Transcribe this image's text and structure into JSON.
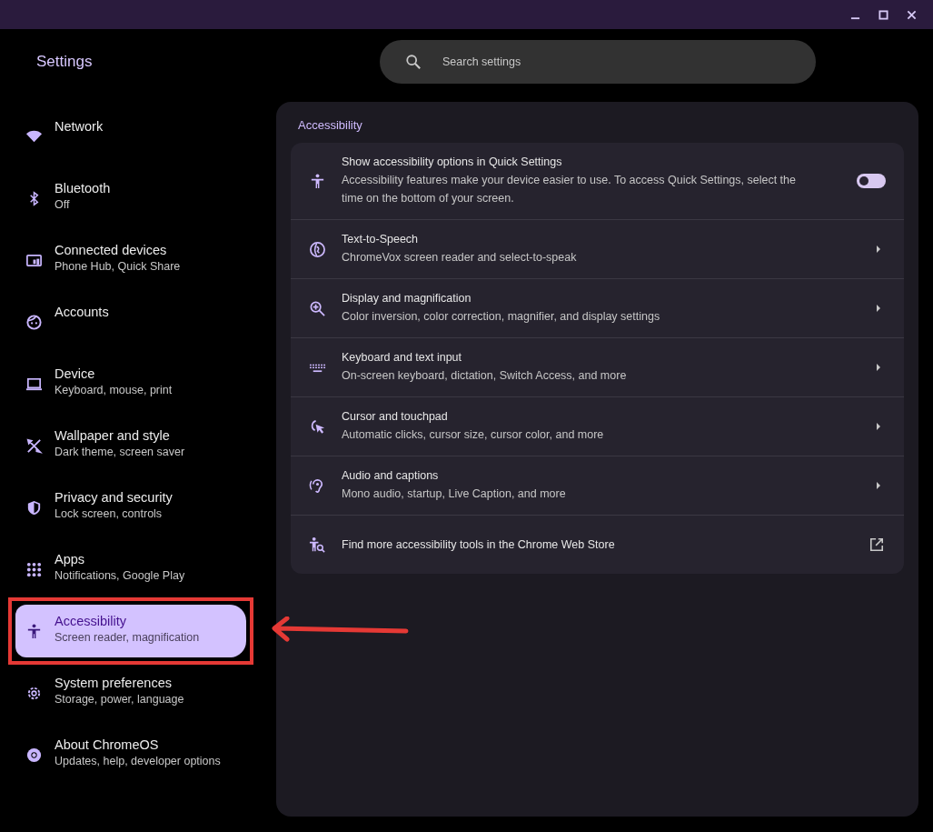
{
  "app_title": "Settings",
  "search": {
    "placeholder": "Search settings"
  },
  "sidebar": {
    "items": [
      {
        "title": "Network",
        "selected": false
      },
      {
        "title": "Bluetooth",
        "subtitle": "Off",
        "selected": false
      },
      {
        "title": "Connected devices",
        "subtitle": "Phone Hub, Quick Share",
        "selected": false
      },
      {
        "title": "Accounts",
        "selected": false
      },
      {
        "title": "Device",
        "subtitle": "Keyboard, mouse, print",
        "selected": false
      },
      {
        "title": "Wallpaper and style",
        "subtitle": "Dark theme, screen saver",
        "selected": false
      },
      {
        "title": "Privacy and security",
        "subtitle": "Lock screen, controls",
        "selected": false
      },
      {
        "title": "Apps",
        "subtitle": "Notifications, Google Play",
        "selected": false
      },
      {
        "title": "Accessibility",
        "subtitle": "Screen reader, magnification",
        "selected": true
      },
      {
        "title": "System preferences",
        "subtitle": "Storage, power, language",
        "selected": false
      },
      {
        "title": "About ChromeOS",
        "subtitle": "Updates, help, developer options",
        "selected": false
      }
    ]
  },
  "section": {
    "title": "Accessibility",
    "rows": [
      {
        "kind": "toggle",
        "title": "Show accessibility options in Quick Settings",
        "subtitle": "Accessibility features make your device easier to use. To access Quick Settings, select the time on the bottom of your screen.",
        "on": false
      },
      {
        "kind": "link",
        "title": "Text-to-Speech",
        "subtitle": "ChromeVox screen reader and select-to-speak"
      },
      {
        "kind": "link",
        "title": "Display and magnification",
        "subtitle": "Color inversion, color correction, magnifier, and display settings"
      },
      {
        "kind": "link",
        "title": "Keyboard and text input",
        "subtitle": "On-screen keyboard, dictation, Switch Access, and more"
      },
      {
        "kind": "link",
        "title": "Cursor and touchpad",
        "subtitle": "Automatic clicks, cursor size, cursor color, and more"
      },
      {
        "kind": "link",
        "title": "Audio and captions",
        "subtitle": "Mono audio, startup, Live Caption, and more"
      },
      {
        "kind": "external",
        "title": "Find more accessibility tools in the Chrome Web Store"
      }
    ]
  }
}
